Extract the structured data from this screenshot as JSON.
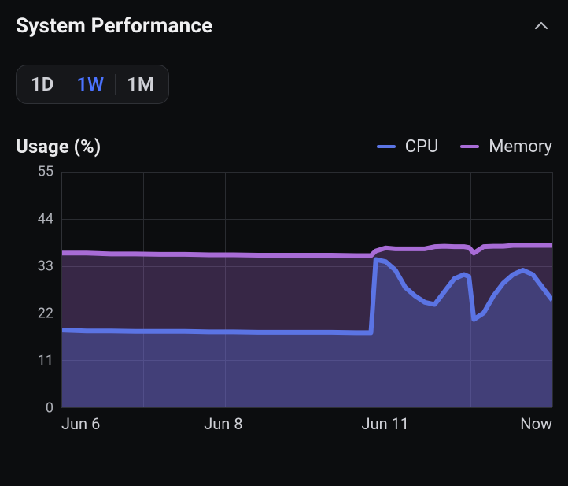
{
  "header": {
    "title": "System Performance"
  },
  "range_selector": {
    "options": [
      "1D",
      "1W",
      "1M"
    ],
    "active_index": 1
  },
  "subtitle": "Usage (%)",
  "legend": [
    {
      "label": "CPU",
      "color": "#5b74e4"
    },
    {
      "label": "Memory",
      "color": "#a86cd6"
    }
  ],
  "chart_data": {
    "type": "area",
    "title": "Usage (%)",
    "xlabel": "",
    "ylabel": "",
    "ylim": [
      0,
      55
    ],
    "y_ticks": [
      0,
      11,
      22,
      33,
      44,
      55
    ],
    "x_ticks": [
      {
        "pos": 0.0,
        "label": "Jun 6"
      },
      {
        "pos": 0.33,
        "label": "Jun 8"
      },
      {
        "pos": 0.66,
        "label": "Jun 11"
      },
      {
        "pos": 1.0,
        "label": "Now"
      }
    ],
    "x_grid": [
      0.166,
      0.333,
      0.5,
      0.666,
      0.833,
      1.0
    ],
    "x": [
      0.0,
      0.05,
      0.1,
      0.15,
      0.2,
      0.25,
      0.3,
      0.35,
      0.4,
      0.45,
      0.5,
      0.55,
      0.6,
      0.63,
      0.64,
      0.66,
      0.68,
      0.7,
      0.72,
      0.74,
      0.76,
      0.78,
      0.8,
      0.82,
      0.83,
      0.84,
      0.86,
      0.88,
      0.9,
      0.92,
      0.94,
      0.96,
      0.98,
      1.0
    ],
    "series": [
      {
        "name": "Memory",
        "color": "#a86cd6",
        "fill": "rgba(168,108,214,0.28)",
        "values": [
          36,
          36,
          35.8,
          35.8,
          35.7,
          35.7,
          35.6,
          35.6,
          35.5,
          35.5,
          35.5,
          35.5,
          35.4,
          35.4,
          36.5,
          37.2,
          37.0,
          37.0,
          37.0,
          37.0,
          37.5,
          37.6,
          37.5,
          37.5,
          37.3,
          36.0,
          37.5,
          37.6,
          37.6,
          37.8,
          37.8,
          37.8,
          37.8,
          37.8
        ]
      },
      {
        "name": "CPU",
        "color": "#5b74e4",
        "fill": "rgba(91,116,228,0.32)",
        "values": [
          18,
          17.8,
          17.8,
          17.7,
          17.7,
          17.7,
          17.6,
          17.6,
          17.5,
          17.5,
          17.5,
          17.5,
          17.4,
          17.4,
          34.5,
          34.0,
          32.0,
          28.0,
          26.0,
          24.5,
          24.0,
          27.0,
          30.0,
          31.0,
          30.5,
          20.5,
          22.0,
          26.0,
          29.0,
          31.0,
          32.0,
          31.0,
          28.0,
          25.0
        ]
      }
    ]
  }
}
